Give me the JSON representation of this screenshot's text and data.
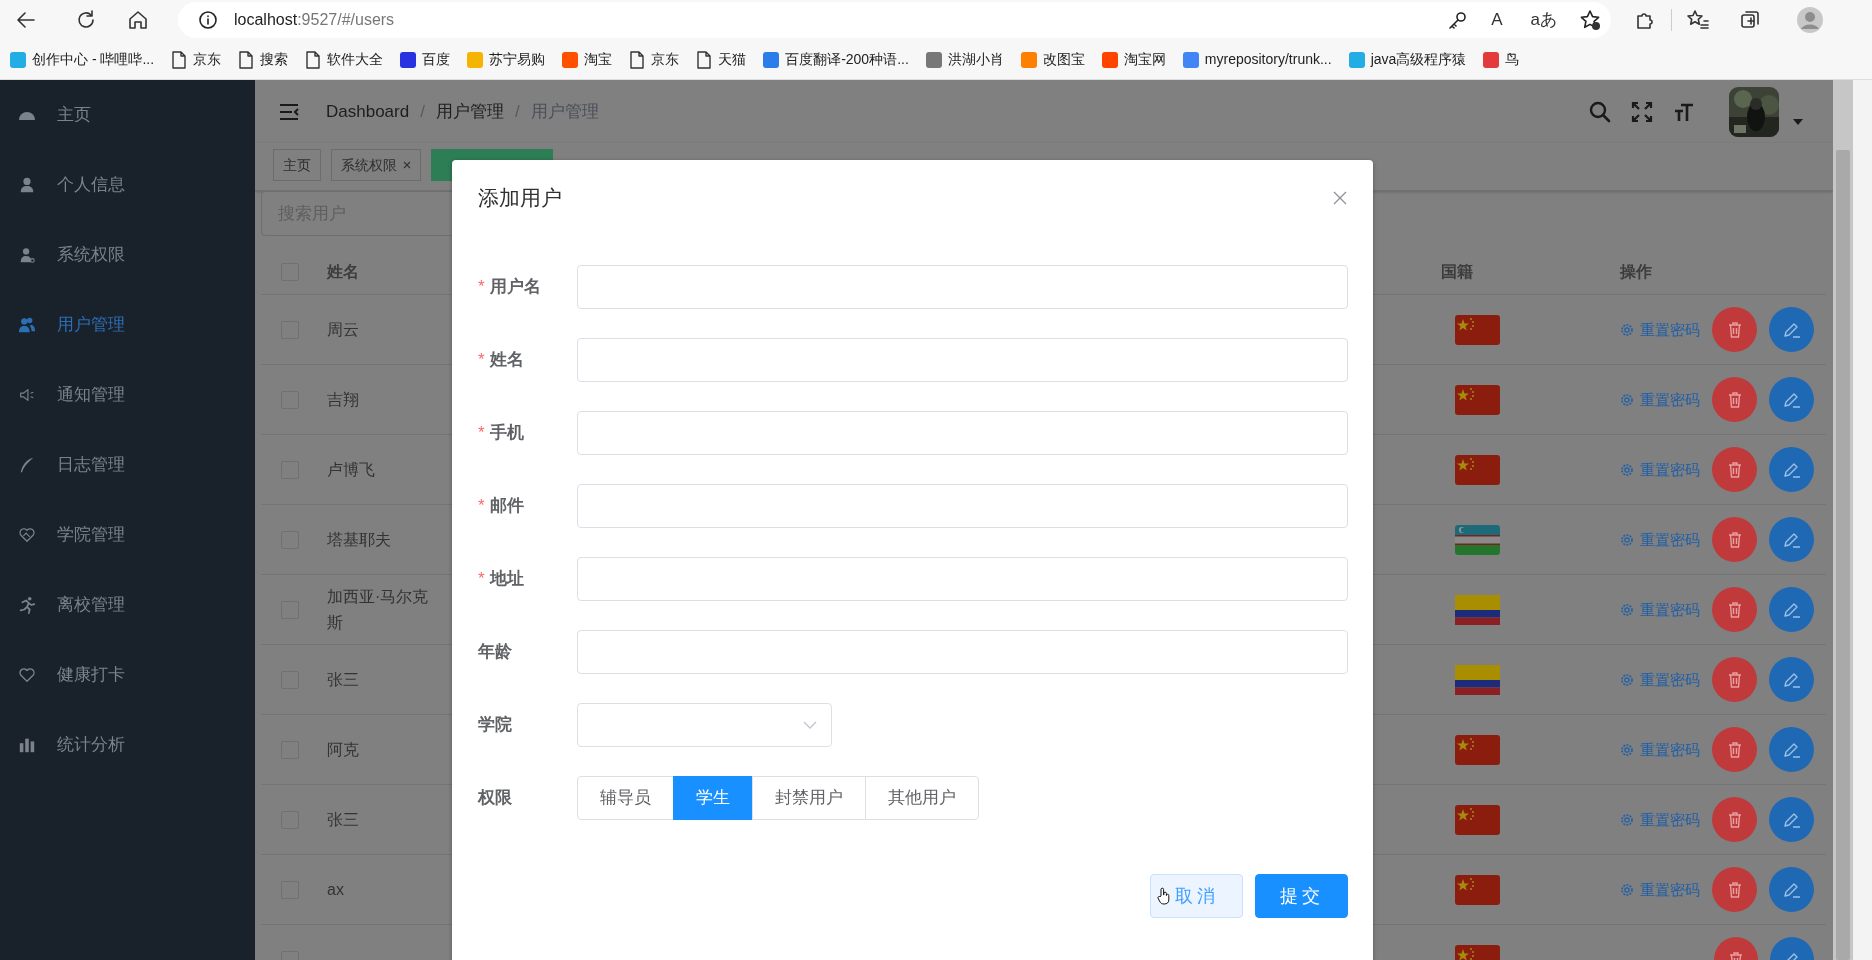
{
  "browser": {
    "url_host": "localhost",
    "url_rest": ":9527/#/users",
    "read_aloud_glyph": "A",
    "translate_glyph": "aあ"
  },
  "bookmarks": [
    {
      "label": "创作中心 - 哔哩哔...",
      "kind": "site",
      "color": "#23ade5"
    },
    {
      "label": "京东",
      "kind": "page"
    },
    {
      "label": "搜索",
      "kind": "page"
    },
    {
      "label": "软件大全",
      "kind": "page"
    },
    {
      "label": "百度",
      "kind": "site",
      "color": "#2932e1"
    },
    {
      "label": "苏宁易购",
      "kind": "site",
      "color": "#f5b400"
    },
    {
      "label": "淘宝",
      "kind": "site",
      "color": "#ff5000"
    },
    {
      "label": "京东",
      "kind": "page"
    },
    {
      "label": "天猫",
      "kind": "page"
    },
    {
      "label": "百度翻译-200种语...",
      "kind": "site",
      "color": "#2b7de9"
    },
    {
      "label": "洪湖小肖",
      "kind": "site",
      "color": "#777777"
    },
    {
      "label": "改图宝",
      "kind": "site",
      "color": "#ff7f00"
    },
    {
      "label": "淘宝网",
      "kind": "site",
      "color": "#ff4400"
    },
    {
      "label": "myrepository/trunk...",
      "kind": "site",
      "color": "#4285f4"
    },
    {
      "label": "java高级程序猿",
      "kind": "site",
      "color": "#23ade5"
    },
    {
      "label": "鸟",
      "kind": "site",
      "color": "#e33b3b"
    }
  ],
  "sidebar": {
    "items": [
      {
        "label": "主页",
        "selected": false
      },
      {
        "label": "个人信息",
        "selected": false
      },
      {
        "label": "系统权限",
        "selected": false
      },
      {
        "label": "用户管理",
        "selected": true
      },
      {
        "label": "通知管理",
        "selected": false
      },
      {
        "label": "日志管理",
        "selected": false
      },
      {
        "label": "学院管理",
        "selected": false
      },
      {
        "label": "离校管理",
        "selected": false
      },
      {
        "label": "健康打卡",
        "selected": false
      },
      {
        "label": "统计分析",
        "selected": false
      }
    ]
  },
  "navbar": {
    "breadcrumb": [
      {
        "label": "Dashboard",
        "current": false
      },
      {
        "separator": "/",
        "label": "用户管理",
        "current": false
      },
      {
        "separator": "/",
        "label": "用户管理",
        "current": true
      }
    ]
  },
  "tags": [
    {
      "label": "主页",
      "closable": false,
      "selected": false
    },
    {
      "label": "系统权限",
      "closable": true,
      "selected": false
    },
    {
      "closable": false,
      "selected": true
    }
  ],
  "search": {
    "placeholder": "搜索用户"
  },
  "table": {
    "select_all_checked": false,
    "columns": [
      {
        "label": "姓名"
      },
      {
        "label": "国籍"
      },
      {
        "label": "操作"
      }
    ],
    "rows": [
      {
        "name": "周云",
        "checked": false,
        "kind": "china",
        "action_label": "重置密码"
      },
      {
        "name": "吉翔",
        "checked": false,
        "kind": "china",
        "action_label": "重置密码"
      },
      {
        "name": "卢博飞",
        "checked": false,
        "kind": "china",
        "action_label": "重置密码"
      },
      {
        "name": "塔基耶夫",
        "checked": false,
        "kind": "uzbekistan",
        "action_label": "重置密码"
      },
      {
        "name": "加西亚·马尔克斯",
        "checked": false,
        "kind": "colombia",
        "action_label": "重置密码"
      },
      {
        "name": "张三",
        "checked": false,
        "kind": "colombia",
        "action_label": "重置密码"
      },
      {
        "name": "阿克",
        "checked": false,
        "kind": "china",
        "action_label": "重置密码"
      },
      {
        "name": "张三",
        "checked": false,
        "kind": "china",
        "action_label": "重置密码"
      },
      {
        "name": "ax",
        "checked": false,
        "kind": "china",
        "action_label": "重置密码"
      },
      {
        "checked": false,
        "kind": "china"
      }
    ]
  },
  "modal": {
    "title": "添加用户",
    "fields": [
      {
        "kind": "text",
        "label": "用户名",
        "required_mark": "*"
      },
      {
        "kind": "text",
        "label": "姓名",
        "required_mark": "*"
      },
      {
        "kind": "text",
        "label": "手机",
        "required_mark": "*"
      },
      {
        "kind": "text",
        "label": "邮件",
        "required_mark": "*"
      },
      {
        "kind": "text",
        "label": "地址",
        "required_mark": "*"
      },
      {
        "kind": "text",
        "label": "年龄"
      },
      {
        "kind": "select",
        "label": "学院"
      },
      {
        "kind": "radio",
        "label": "权限",
        "options": [
          {
            "label": "辅导员",
            "selected": false
          },
          {
            "label": "学生",
            "selected": true
          },
          {
            "label": "封禁用户",
            "selected": false
          },
          {
            "label": "其他用户",
            "selected": false
          }
        ]
      }
    ],
    "buttons": [
      {
        "label": "取消",
        "kind": "default",
        "hovered": true
      },
      {
        "label": "提交",
        "kind": "primary",
        "hovered": false
      }
    ]
  }
}
